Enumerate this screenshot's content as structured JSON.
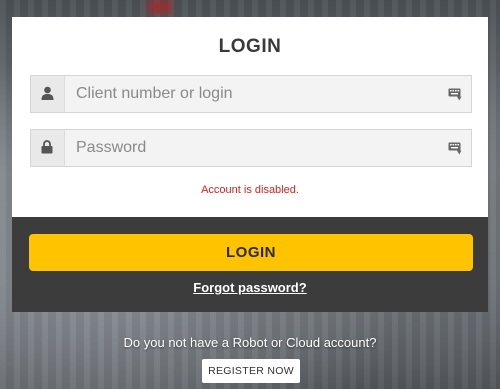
{
  "login_card": {
    "title": "LOGIN",
    "username": {
      "placeholder": "Client number or login",
      "value": "",
      "icon": "user-icon",
      "keyboard_icon": "virtual-keyboard-icon"
    },
    "password": {
      "placeholder": "Password",
      "value": "",
      "icon": "lock-icon",
      "keyboard_icon": "virtual-keyboard-icon"
    },
    "error_message": "Account is disabled."
  },
  "actions": {
    "login_label": "LOGIN",
    "forgot_password_label": "Forgot password?"
  },
  "register": {
    "question": "Do you not have a Robot or Cloud account?",
    "button_label": "REGISTER NOW"
  },
  "colors": {
    "accent": "#ffc300",
    "error": "#d41f1f",
    "panel": "#3c3c3c"
  }
}
